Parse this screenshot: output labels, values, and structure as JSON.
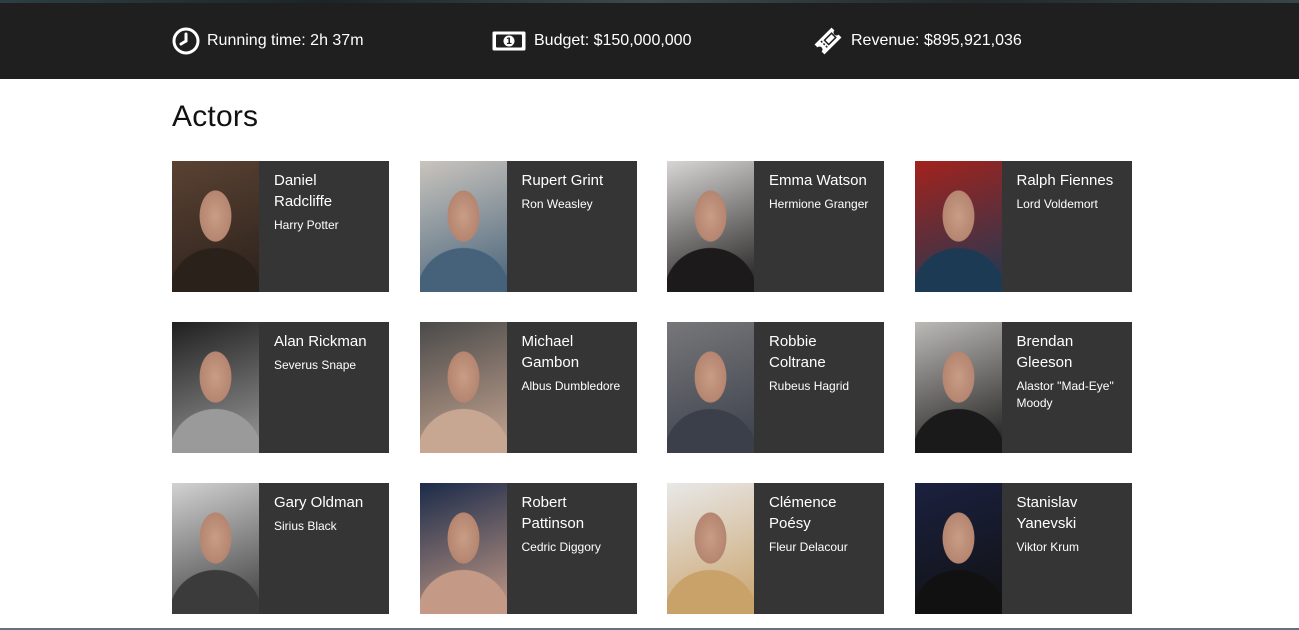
{
  "stats": {
    "running_time": "Running time: 2h 37m",
    "budget": "Budget: $150,000,000",
    "revenue": "Revenue: $895,921,036",
    "running_time_icon": "clock-icon",
    "budget_icon": "banknote-icon",
    "revenue_icon": "ticket-icon"
  },
  "actors_section": {
    "title": "Actors"
  },
  "actors": [
    {
      "name": "Daniel Radcliffe",
      "character": "Harry Potter",
      "photo_colors": [
        "#5a4233",
        "#2b211b"
      ]
    },
    {
      "name": "Rupert Grint",
      "character": "Ron Weasley",
      "photo_colors": [
        "#c9c4bd",
        "#46627a"
      ]
    },
    {
      "name": "Emma Watson",
      "character": "Hermione Granger",
      "photo_colors": [
        "#d8d6d4",
        "#1c1a1a"
      ]
    },
    {
      "name": "Ralph Fiennes",
      "character": "Lord Voldemort",
      "photo_colors": [
        "#a3221d",
        "#1d3a55"
      ]
    },
    {
      "name": "Alan Rickman",
      "character": "Severus Snape",
      "photo_colors": [
        "#202020",
        "#9a9a9a"
      ]
    },
    {
      "name": "Michael Gambon",
      "character": "Albus Dumbledore",
      "photo_colors": [
        "#4a4a4a",
        "#c7a692"
      ]
    },
    {
      "name": "Robbie Coltrane",
      "character": "Rubeus Hagrid",
      "photo_colors": [
        "#77777a",
        "#3a3f4a"
      ]
    },
    {
      "name": "Brendan Gleeson",
      "character": "Alastor \"Mad-Eye\" Moody",
      "photo_colors": [
        "#bcbab7",
        "#1a1a1a"
      ]
    },
    {
      "name": "Gary Oldman",
      "character": "Sirius Black",
      "photo_colors": [
        "#d2d2d2",
        "#3b3b3b"
      ]
    },
    {
      "name": "Robert Pattinson",
      "character": "Cedric Diggory",
      "photo_colors": [
        "#1b2b4a",
        "#c49a86"
      ]
    },
    {
      "name": "Clémence Poésy",
      "character": "Fleur Delacour",
      "photo_colors": [
        "#e8e8e8",
        "#c9a26a"
      ]
    },
    {
      "name": "Stanislav Yanevski",
      "character": "Viktor Krum",
      "photo_colors": [
        "#1b2140",
        "#111111"
      ]
    }
  ]
}
